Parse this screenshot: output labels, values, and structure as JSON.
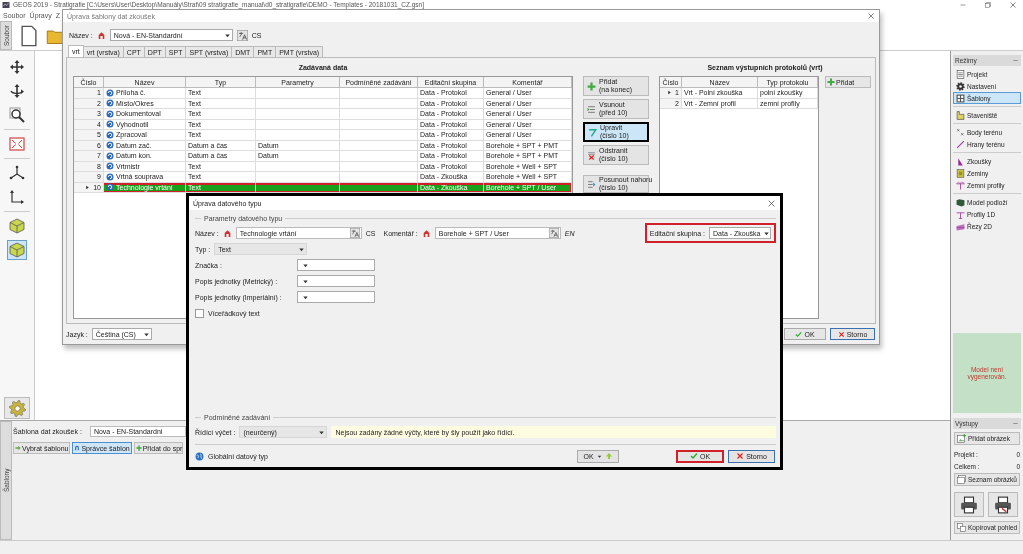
{
  "window": {
    "title": "GEOS 2019 - Stratigrafie [C:\\Users\\User\\Desktop\\Manuály\\Strat\\09 stratigrafie_manual\\d0_stratigrafie\\DEMO - Templates - 20181031_CZ.gsn]"
  },
  "menu": [
    "Soubor",
    "Úpravy",
    "Z"
  ],
  "ribbon_tab": "Soubor",
  "tools": [
    {
      "kind": "move",
      "selected": false
    },
    {
      "kind": "rotate",
      "selected": false
    },
    {
      "kind": "zoom",
      "selected": false
    },
    {
      "kind": "extent",
      "selected": false
    },
    {
      "kind": "axes",
      "selected": false
    },
    {
      "kind": "corner",
      "selected": false
    },
    {
      "kind": "cube",
      "selected": false
    },
    {
      "kind": "cube",
      "selected": true
    }
  ],
  "modes": {
    "title": "Režimy",
    "groups": [
      [
        {
          "label": "Projekt",
          "kind": "list",
          "selected": false
        },
        {
          "label": "Nastavení",
          "kind": "gear",
          "selected": false
        },
        {
          "label": "Šablony",
          "kind": "template",
          "selected": true
        }
      ],
      [
        {
          "label": "Staveniště",
          "kind": "site",
          "selected": false
        }
      ],
      [
        {
          "label": "Body terénu",
          "kind": "points",
          "selected": false
        },
        {
          "label": "Hrany terénu",
          "kind": "line",
          "selected": false
        }
      ],
      [
        {
          "label": "Zkoušky",
          "kind": "test",
          "selected": false
        },
        {
          "label": "Zeminy",
          "kind": "soil",
          "selected": false
        },
        {
          "label": "Zemní profily",
          "kind": "profile",
          "selected": false
        }
      ],
      [
        {
          "label": "Model podloží",
          "kind": "model",
          "selected": false
        },
        {
          "label": "Profily 1D",
          "kind": "profile1d",
          "selected": false
        },
        {
          "label": "Řezy 2D",
          "kind": "section",
          "selected": false
        }
      ]
    ]
  },
  "model_status": "Model není vygenerován.",
  "outputs": {
    "title": "Výstupy",
    "add_button": "Přidat obrázek",
    "counts": [
      {
        "label": "Projekt :",
        "value": "0"
      },
      {
        "label": "Celkem :",
        "value": "0"
      }
    ],
    "list_button": "Seznam obrázků",
    "copy_button": "Kopírovat pohled"
  },
  "templates_panel": {
    "tab": "Šablony",
    "label": "Šablona dat zkoušek :",
    "value": "Nova - EN-Standardni",
    "buttons": [
      {
        "label": "Vybrat šablonu",
        "kind": "select",
        "selected": false
      },
      {
        "label": "Správce šablon",
        "kind": "manager",
        "selected": true
      },
      {
        "label": "Přidat do spr",
        "kind": "add",
        "selected": false
      }
    ]
  },
  "template_dialog": {
    "title": "Úprava šablony dat zkoušek",
    "name_label": "Název :",
    "name_value": "Nová - EN-Standardní",
    "language": "CS",
    "tabs": [
      {
        "label": "vrt",
        "selected": true
      },
      {
        "label": "vrt (vrstva)",
        "selected": false
      },
      {
        "label": "CPT",
        "selected": false
      },
      {
        "label": "DPT",
        "selected": false
      },
      {
        "label": "SPT",
        "selected": false
      },
      {
        "label": "SPT (vrstva)",
        "selected": false
      },
      {
        "label": "DMT",
        "selected": false
      },
      {
        "label": "PMT",
        "selected": false
      },
      {
        "label": "PMT (vrstva)",
        "selected": false
      }
    ],
    "input_section": {
      "title": "Zadávaná data",
      "columns": [
        "Číslo",
        "Název",
        "Typ",
        "Parametry",
        "Podmíněné zadávání",
        "Editační skupina",
        "Komentář"
      ],
      "rows": [
        {
          "number": "1",
          "name": "Příloha č.",
          "type": "Text",
          "group": "Data - Protokol",
          "comment": "General / User",
          "selected": false,
          "highlighted": false
        },
        {
          "number": "2",
          "name": "Místo/Okres",
          "type": "Text",
          "group": "Data - Protokol",
          "comment": "General / User",
          "selected": false,
          "highlighted": false
        },
        {
          "number": "3",
          "name": "Dokumentoval",
          "type": "Text",
          "group": "Data - Protokol",
          "comment": "General / User",
          "selected": false,
          "highlighted": false
        },
        {
          "number": "4",
          "name": "Vyhodnotil",
          "type": "Text",
          "group": "Data - Protokol",
          "comment": "General / User",
          "selected": false,
          "highlighted": false
        },
        {
          "number": "5",
          "name": "Zpracoval",
          "type": "Text",
          "group": "Data - Protokol",
          "comment": "General / User",
          "selected": false,
          "highlighted": false
        },
        {
          "number": "6",
          "name": "Datum zač.",
          "type": "Datum a čas",
          "parameters": "Datum",
          "group": "Data - Protokol",
          "comment": "Borehole + SPT + PMT",
          "selected": false,
          "highlighted": false
        },
        {
          "number": "7",
          "name": "Datum kon.",
          "type": "Datum a čas",
          "parameters": "Datum",
          "group": "Data - Protokol",
          "comment": "Borehole + SPT + PMT",
          "selected": false,
          "highlighted": false
        },
        {
          "number": "8",
          "name": "Vrtmistr",
          "type": "Text",
          "group": "Data - Protokol",
          "comment": "Borehole + Well + SPT",
          "selected": false,
          "highlighted": false
        },
        {
          "number": "9",
          "name": "Vrtná souprava",
          "type": "Text",
          "group": "Data - Zkouška",
          "comment": "Borehole + Well + SPT",
          "selected": false,
          "highlighted": false
        },
        {
          "number": "10",
          "name": "Technologie vrtání",
          "type": "Text",
          "group": "Data - Zkouška",
          "comment": "Borehole + SPT / User",
          "selected": true,
          "highlighted": true
        }
      ]
    },
    "actions": [
      {
        "kind": "add",
        "lines": [
          "Přidat",
          "(na konec)"
        ],
        "selected": false
      },
      {
        "kind": "insert",
        "lines": [
          "Vsunout",
          "(před 10)"
        ],
        "selected": false
      },
      {
        "kind": "edit",
        "lines": [
          "Upravit",
          "(číslo 10)"
        ],
        "selected": true
      },
      {
        "kind": "delete",
        "lines": [
          "Odstranit",
          "(číslo 10)"
        ],
        "selected": false
      },
      {
        "kind": "moveup",
        "lines": [
          "Posunout nahoru",
          "(číslo 10)"
        ],
        "selected": false
      }
    ],
    "output_section": {
      "title": "Seznam výstupních protokolů (vrt)",
      "columns": [
        "Číslo",
        "Název",
        "Typ protokolu"
      ],
      "rows": [
        {
          "number": "1",
          "name": "Vrt - Polní zkouška",
          "type": "polní zkoušky",
          "selected": true
        },
        {
          "number": "2",
          "name": "Vrt - Zemní profil",
          "type": "zemní profily",
          "selected": false
        }
      ],
      "add_button": "Přidat"
    },
    "language_label": "Jazyk :",
    "language_value": "Čeština (CS)",
    "buttons": [
      {
        "kind": "ok",
        "label": "OK"
      },
      {
        "kind": "cancel",
        "label": "Storno"
      }
    ]
  },
  "type_dialog": {
    "title": "Úprava datového typu",
    "parameters_group": "Parametry datového typu",
    "name": {
      "label": "Název :",
      "value": "Technologie vrtání",
      "language": "CS"
    },
    "comment": {
      "label": "Komentář :",
      "value": "Borehole + SPT / User",
      "language": "EN"
    },
    "edit_group": {
      "label": "Editační skupina :",
      "value": "Data - Zkouška",
      "highlighted": true
    },
    "type": {
      "label": "Typ :",
      "value": "Text",
      "disabled": true
    },
    "fields": [
      {
        "label": "Značka :"
      },
      {
        "label": "Popis jednotky (Metrický) :"
      },
      {
        "label": "Popis jednotky (Imperiální) :"
      }
    ],
    "multiline": {
      "label": "Víceřádkový text",
      "checked": false
    },
    "conditional_group": "Podmíněné zadávání",
    "control": {
      "label": "Řídící výčet :",
      "value": "(neurčený)"
    },
    "note": "Nejsou zadány žádné výčty, které by šly použít jako řídící.",
    "global_label": "Globální datový typ",
    "buttons": [
      {
        "kind": "ok-menu",
        "label": "OK",
        "highlighted": false
      },
      {
        "kind": "ok",
        "label": "OK",
        "highlighted": true
      },
      {
        "kind": "cancel",
        "label": "Storno",
        "highlighted": false
      }
    ]
  }
}
